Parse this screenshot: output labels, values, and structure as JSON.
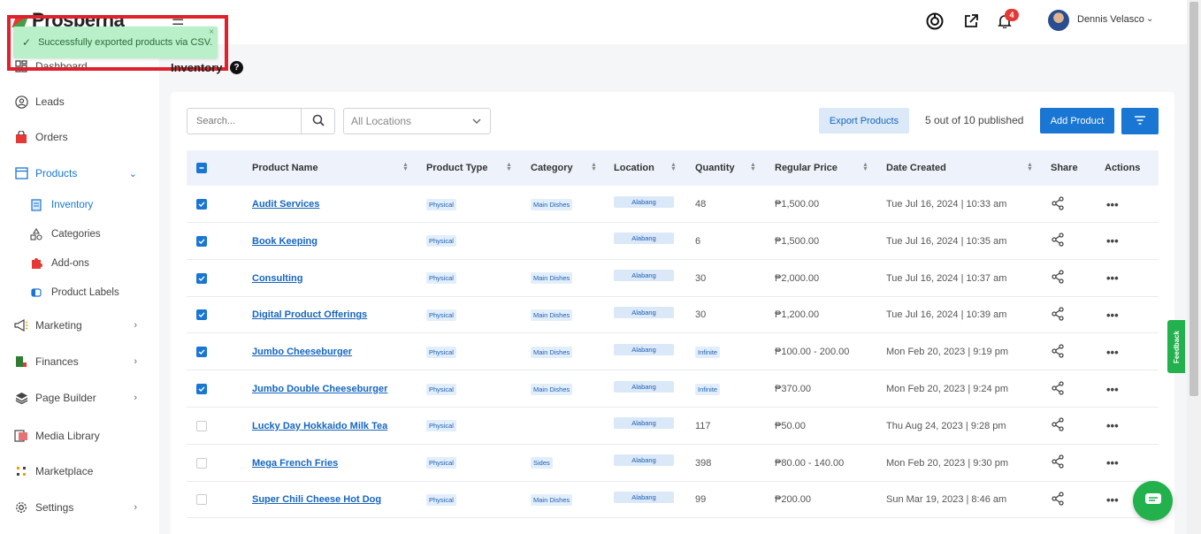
{
  "app": {
    "logo_text": "Prosperna"
  },
  "toast": {
    "message": "Successfully exported products via CSV.",
    "close": "×"
  },
  "sidebar": {
    "items": [
      {
        "label": "Dashboard"
      },
      {
        "label": "Leads"
      },
      {
        "label": "Orders"
      },
      {
        "label": "Products"
      },
      {
        "label": "Marketing"
      },
      {
        "label": "Finances"
      },
      {
        "label": "Page Builder"
      },
      {
        "label": "Media Library"
      },
      {
        "label": "Marketplace"
      },
      {
        "label": "Settings"
      }
    ],
    "products_sub": [
      {
        "label": "Inventory"
      },
      {
        "label": "Categories"
      },
      {
        "label": "Add-ons"
      },
      {
        "label": "Product Labels"
      }
    ]
  },
  "header": {
    "notification_count": "4",
    "user_name": "Dennis Velasco"
  },
  "page": {
    "title": "Inventory",
    "help": "?"
  },
  "toolbar": {
    "search_placeholder": "Search...",
    "location_selected": "All Locations",
    "export_label": "Export Products",
    "publish_count": "5 out of 10 published",
    "add_label": "Add Product"
  },
  "table": {
    "headers": {
      "name": "Product Name",
      "type": "Product Type",
      "category": "Category",
      "location": "Location",
      "quantity": "Quantity",
      "price": "Regular Price",
      "date": "Date Created",
      "share": "Share",
      "actions": "Actions"
    },
    "rows": [
      {
        "checked": true,
        "name": "Audit Services",
        "type": "Physical",
        "category": "Main Dishes",
        "location": "Alabang",
        "quantity": "48",
        "quantity_tag": false,
        "price": "₱1,500.00",
        "date": "Tue Jul 16, 2024 | 10:33 am"
      },
      {
        "checked": true,
        "name": "Book Keeping",
        "type": "Physical",
        "category": "",
        "location": "Alabang",
        "quantity": "6",
        "quantity_tag": false,
        "price": "₱1,500.00",
        "date": "Tue Jul 16, 2024 | 10:35 am"
      },
      {
        "checked": true,
        "name": "Consulting",
        "type": "Physical",
        "category": "Main Dishes",
        "location": "Alabang",
        "quantity": "30",
        "quantity_tag": false,
        "price": "₱2,000.00",
        "date": "Tue Jul 16, 2024 | 10:37 am"
      },
      {
        "checked": true,
        "name": "Digital Product Offerings",
        "type": "Physical",
        "category": "Main Dishes",
        "location": "Alabang",
        "quantity": "30",
        "quantity_tag": false,
        "price": "₱1,200.00",
        "date": "Tue Jul 16, 2024 | 10:39 am"
      },
      {
        "checked": true,
        "name": "Jumbo Cheeseburger",
        "type": "Physical",
        "category": "Main Dishes",
        "location": "Alabang",
        "quantity": "Infinite",
        "quantity_tag": true,
        "price": "₱100.00 - 200.00",
        "date": "Mon Feb 20, 2023 | 9:19 pm"
      },
      {
        "checked": true,
        "name": "Jumbo Double Cheeseburger",
        "type": "Physical",
        "category": "Main Dishes",
        "location": "Alabang",
        "quantity": "Infinite",
        "quantity_tag": true,
        "price": "₱370.00",
        "date": "Mon Feb 20, 2023 | 9:24 pm"
      },
      {
        "checked": false,
        "name": "Lucky Day Hokkaido Milk Tea",
        "type": "Physical",
        "category": "",
        "location": "Alabang",
        "quantity": "117",
        "quantity_tag": false,
        "price": "₱50.00",
        "date": "Thu Aug 24, 2023 | 9:28 pm"
      },
      {
        "checked": false,
        "name": "Mega French Fries",
        "type": "Physical",
        "category": "Sides",
        "location": "Alabang",
        "quantity": "398",
        "quantity_tag": false,
        "price": "₱80.00 - 140.00",
        "date": "Mon Feb 20, 2023 | 9:30 pm"
      },
      {
        "checked": false,
        "name": "Super Chili Cheese Hot Dog",
        "type": "Physical",
        "category": "Main Dishes",
        "location": "Alabang",
        "quantity": "99",
        "quantity_tag": false,
        "price": "₱200.00",
        "date": "Sun Mar 19, 2023 | 8:46 am"
      }
    ]
  },
  "feedback": {
    "label": "Feedback"
  },
  "colors": {
    "primary": "#1976d2",
    "toast_bg": "#b9f0c9",
    "highlight": "#e0202a",
    "badge": "#e53935",
    "chat": "#22b14c"
  }
}
